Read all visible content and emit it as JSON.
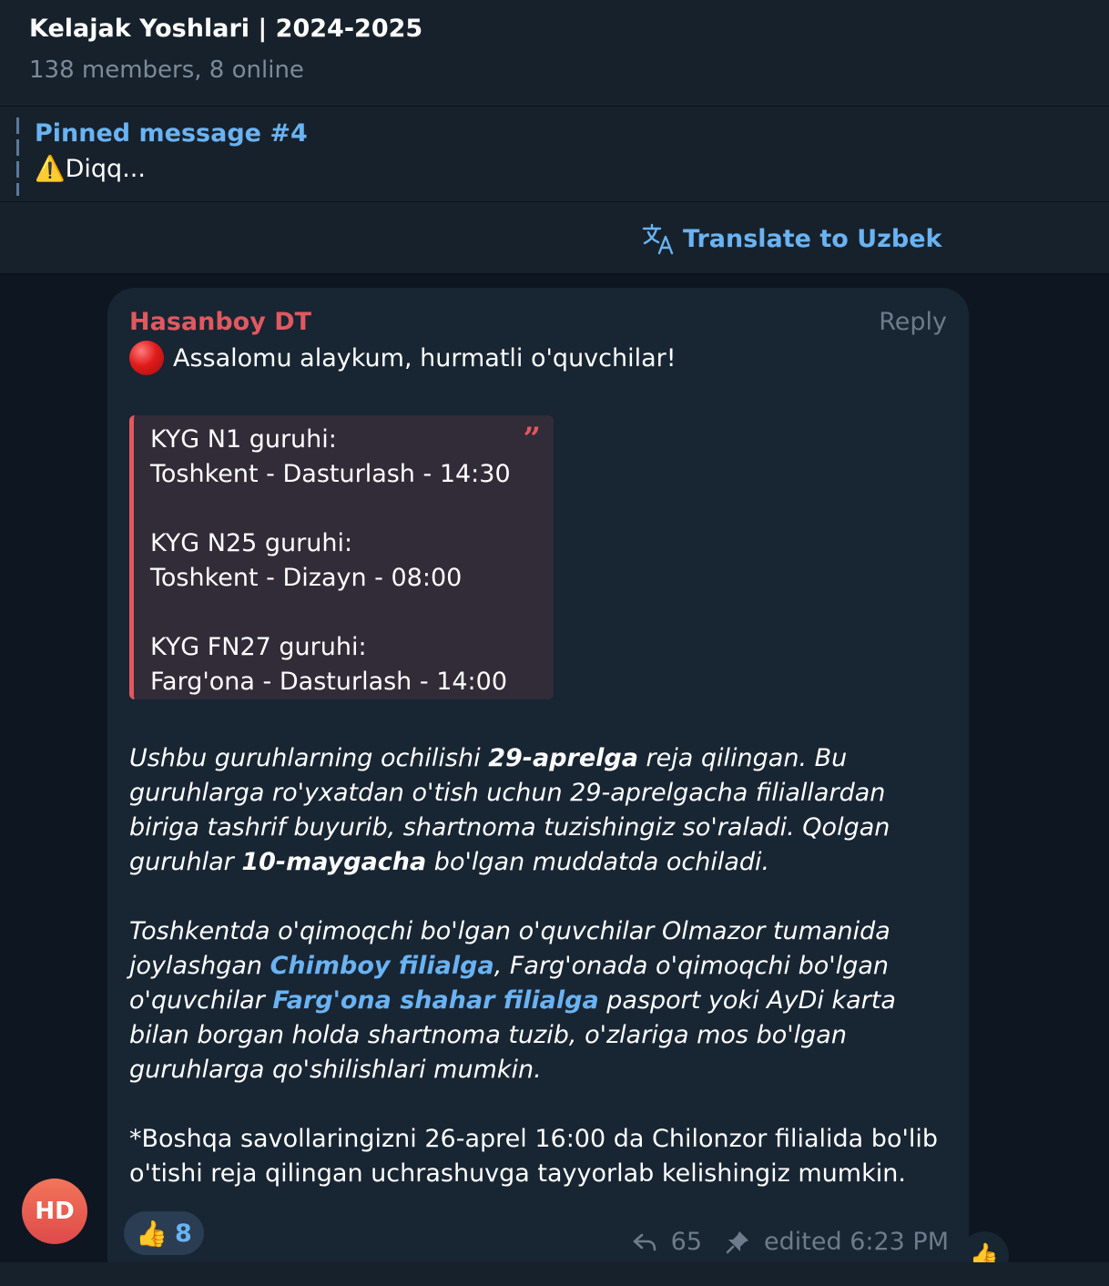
{
  "header": {
    "title": "Kelajak Yoshlari | 2024-2025",
    "subtitle": "138 members, 8 online"
  },
  "pinned": {
    "label": "Pinned message #4",
    "text": "⚠️Diqq..."
  },
  "translate": {
    "label": "Translate to Uzbek",
    "icon": "translate-icon"
  },
  "message": {
    "sender": "Hasanboy DT",
    "sender_color": "#e0595f",
    "reply_label": "Reply",
    "greeting": "Assalomu alaykum, hurmatli o'quvchilar!",
    "quote_lines": [
      "KYG N1 guruhi:",
      "Toshkent - Dasturlash - 14:30",
      "",
      "KYG N25 guruhi:",
      "Toshkent - Dizayn - 08:00",
      "",
      "KYG FN27 guruhi:",
      "Farg'ona - Dasturlash - 14:00"
    ],
    "p1": {
      "a": "Ushbu guruhlarning ochilishi ",
      "b": "29-aprelga",
      "c": " reja qilingan. Bu guruhlarga ro'yxatdan o'tish uchun 29-aprelgacha filiallardan biriga tashrif buyurib, shartnoma tuzishingiz so'raladi. Qolgan guruhlar ",
      "d": "10-maygacha",
      "e": " bo'lgan muddatda ochiladi."
    },
    "p2": {
      "a": "Toshkentda o'qimoqchi bo'lgan o'quvchilar Olmazor tumanida joylashgan ",
      "link1": "Chimboy filialga",
      "b": ",  Farg'onada o'qimoqchi bo'lgan o'quvchilar ",
      "link2": "Farg'ona shahar filialga",
      "c": " pasport yoki AyDi karta bilan borgan holda shartnoma tuzib, o'zlariga mos bo'lgan guruhlarga qo'shilishlari mumkin."
    },
    "p3": "*Boshqa savollaringizni 26-aprel 16:00 da Chilonzor filialida bo'lib o'tishi reja qilingan uchrashuvga tayyorlab kelishingiz mumkin.",
    "reaction": {
      "emoji": "👍",
      "count": "8"
    },
    "forwards": "65",
    "edited": "edited 6:23 PM"
  },
  "avatar": {
    "initials": "HD"
  },
  "react_button_emoji": "👍",
  "colors": {
    "background": "#0e1621",
    "panel": "#17212b",
    "bubble": "#182533",
    "accent": "#6ab3f3",
    "quote_bg": "#322b38"
  }
}
